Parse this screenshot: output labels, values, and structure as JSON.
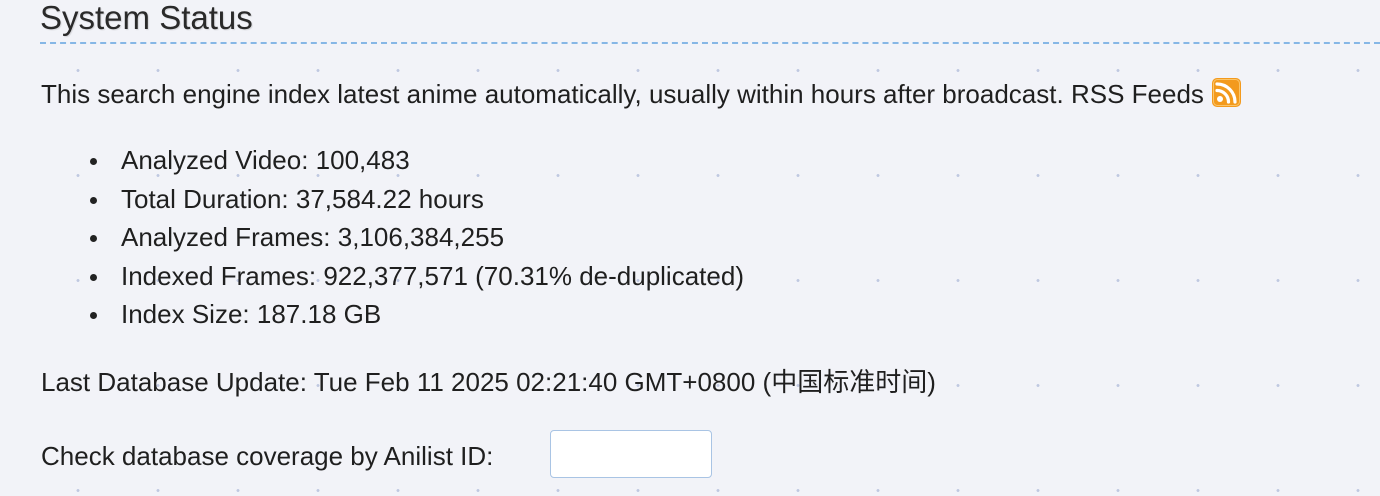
{
  "section": {
    "title": "System Status"
  },
  "description": {
    "text": "This search engine index latest anime automatically, usually within hours after broadcast.",
    "rss_label": "RSS Feeds",
    "rss_icon": "rss-icon",
    "rss_color": "#f39a1d"
  },
  "stats": [
    {
      "label": "Analyzed Video:",
      "value": "100,483"
    },
    {
      "label": "Total Duration:",
      "value": "37,584.22 hours"
    },
    {
      "label": "Analyzed Frames:",
      "value": "3,106,384,255"
    },
    {
      "label": "Indexed Frames:",
      "value": "922,377,571 (70.31% de-duplicated)"
    },
    {
      "label": "Index Size:",
      "value": "187.18 GB"
    }
  ],
  "last_update": {
    "label": "Last Database Update:",
    "value": "Tue Feb 11 2025 02:21:40 GMT+0800 (中国标准时间)"
  },
  "coverage": {
    "label": "Check database coverage by Anilist ID:",
    "input_value": ""
  }
}
